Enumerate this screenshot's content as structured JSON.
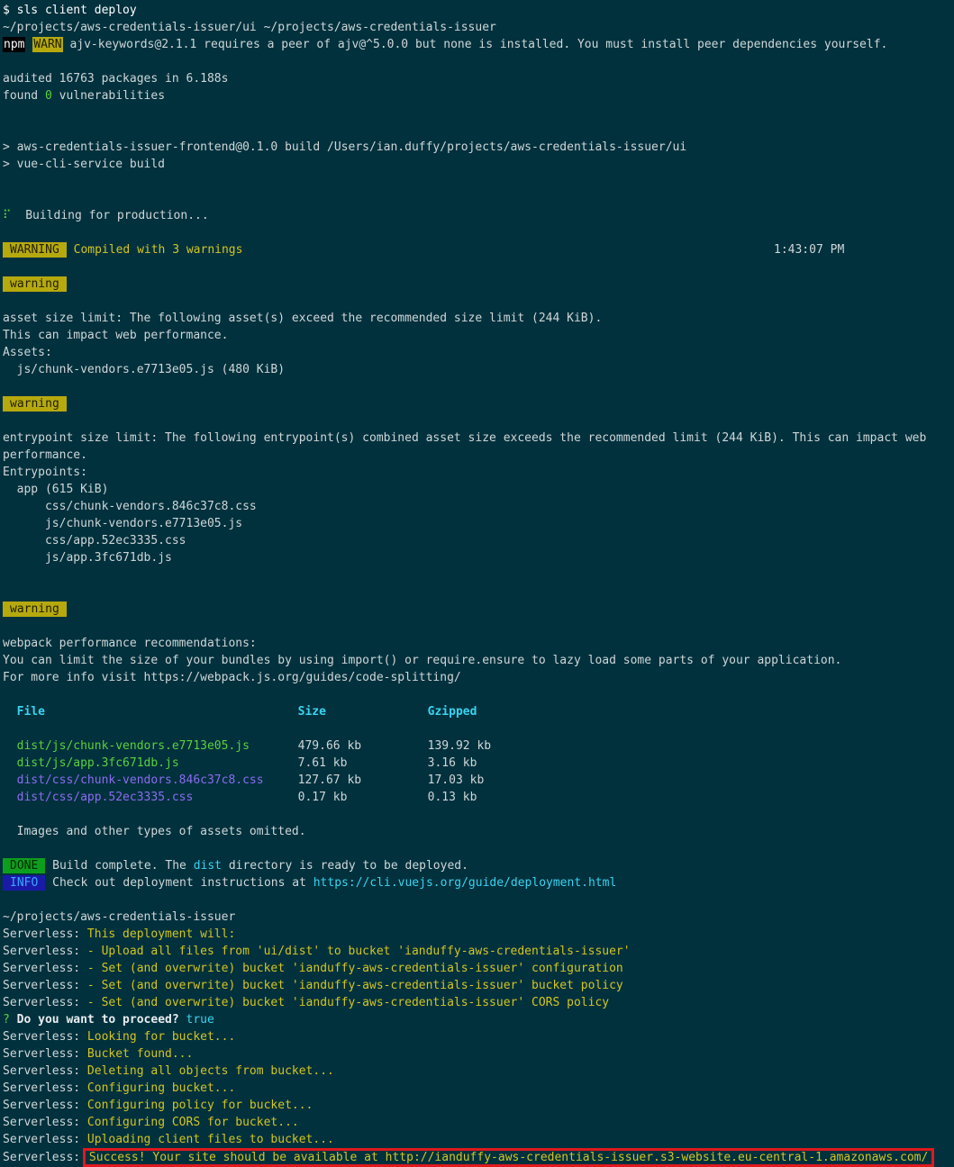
{
  "prompt": {
    "symbol": "$",
    "command": "sls client deploy"
  },
  "cwd_line": "~/projects/aws-credentials-issuer/ui ~/projects/aws-credentials-issuer",
  "npm_warn": {
    "npm": "npm",
    "warn": "WARN",
    "text": "ajv-keywords@2.1.1 requires a peer of ajv@^5.0.0 but none is installed. You must install peer dependencies yourself."
  },
  "audit": {
    "audited": "audited 16763 packages in 6.188s",
    "found_pre": "found ",
    "count": "0",
    "found_post": " vulnerabilities"
  },
  "build_cmd": [
    "> aws-credentials-issuer-frontend@0.1.0 build /Users/ian.duffy/projects/aws-credentials-issuer/ui",
    "> vue-cli-service build"
  ],
  "building": {
    "spinner": "⠏",
    "text": "Building for production..."
  },
  "compiled": {
    "badge": "WARNING",
    "text": "Compiled with 3 warnings",
    "time": "1:43:07 PM"
  },
  "warning_label": "warning",
  "warn1": [
    "asset size limit: The following asset(s) exceed the recommended size limit (244 KiB).",
    "This can impact web performance.",
    "Assets:",
    "  js/chunk-vendors.e7713e05.js (480 KiB)"
  ],
  "warn2": [
    "entrypoint size limit: The following entrypoint(s) combined asset size exceeds the recommended limit (244 KiB). This can impact web",
    "performance.",
    "Entrypoints:",
    "  app (615 KiB)",
    "      css/chunk-vendors.846c37c8.css",
    "      js/chunk-vendors.e7713e05.js",
    "      css/app.52ec3335.css",
    "      js/app.3fc671db.js"
  ],
  "warn3": [
    "webpack performance recommendations:",
    "You can limit the size of your bundles by using import() or require.ensure to lazy load some parts of your application.",
    "For more info visit https://webpack.js.org/guides/code-splitting/"
  ],
  "files_table": {
    "headers": [
      "File",
      "Size",
      "Gzipped"
    ],
    "rows": [
      {
        "file": "dist/js/chunk-vendors.e7713e05.js",
        "size": "479.66 kb",
        "gzip": "139.92 kb",
        "kind": "js"
      },
      {
        "file": "dist/js/app.3fc671db.js",
        "size": "7.61 kb",
        "gzip": "3.16 kb",
        "kind": "js"
      },
      {
        "file": "dist/css/chunk-vendors.846c37c8.css",
        "size": "127.67 kb",
        "gzip": "17.03 kb",
        "kind": "css"
      },
      {
        "file": "dist/css/app.52ec3335.css",
        "size": "0.17 kb",
        "gzip": "0.13 kb",
        "kind": "css"
      }
    ],
    "footer": "  Images and other types of assets omitted."
  },
  "done": {
    "badge": "DONE",
    "pre": "Build complete. The ",
    "dist": "dist",
    "post": " directory is ready to be deployed."
  },
  "info": {
    "badge": "INFO",
    "pre": "Check out deployment instructions at ",
    "url": "https://cli.vuejs.org/guide/deployment.html"
  },
  "cwd2": "~/projects/aws-credentials-issuer",
  "serverless_prefix": "Serverless: ",
  "sls_plan": [
    "This deployment will:",
    "- Upload all files from 'ui/dist' to bucket 'ianduffy-aws-credentials-issuer'",
    "- Set (and overwrite) bucket 'ianduffy-aws-credentials-issuer' configuration",
    "- Set (and overwrite) bucket 'ianduffy-aws-credentials-issuer' bucket policy",
    "- Set (and overwrite) bucket 'ianduffy-aws-credentials-issuer' CORS policy"
  ],
  "question": {
    "mark": "?",
    "text": "Do you want to proceed?",
    "answer": "true"
  },
  "sls_steps": [
    "Looking for bucket...",
    "Bucket found...",
    "Deleting all objects from bucket...",
    "Configuring bucket...",
    "Configuring policy for bucket...",
    "Configuring CORS for bucket...",
    "Uploading client files to bucket..."
  ],
  "success": "Success! Your site should be available at http://ianduffy-aws-credentials-issuer.s3-website.eu-central-1.amazonaws.com/",
  "colors": {
    "background": "#00313d",
    "yellow": "#d4c422",
    "cyan": "#3ad3f0",
    "highlight_border": "#e0191d"
  }
}
